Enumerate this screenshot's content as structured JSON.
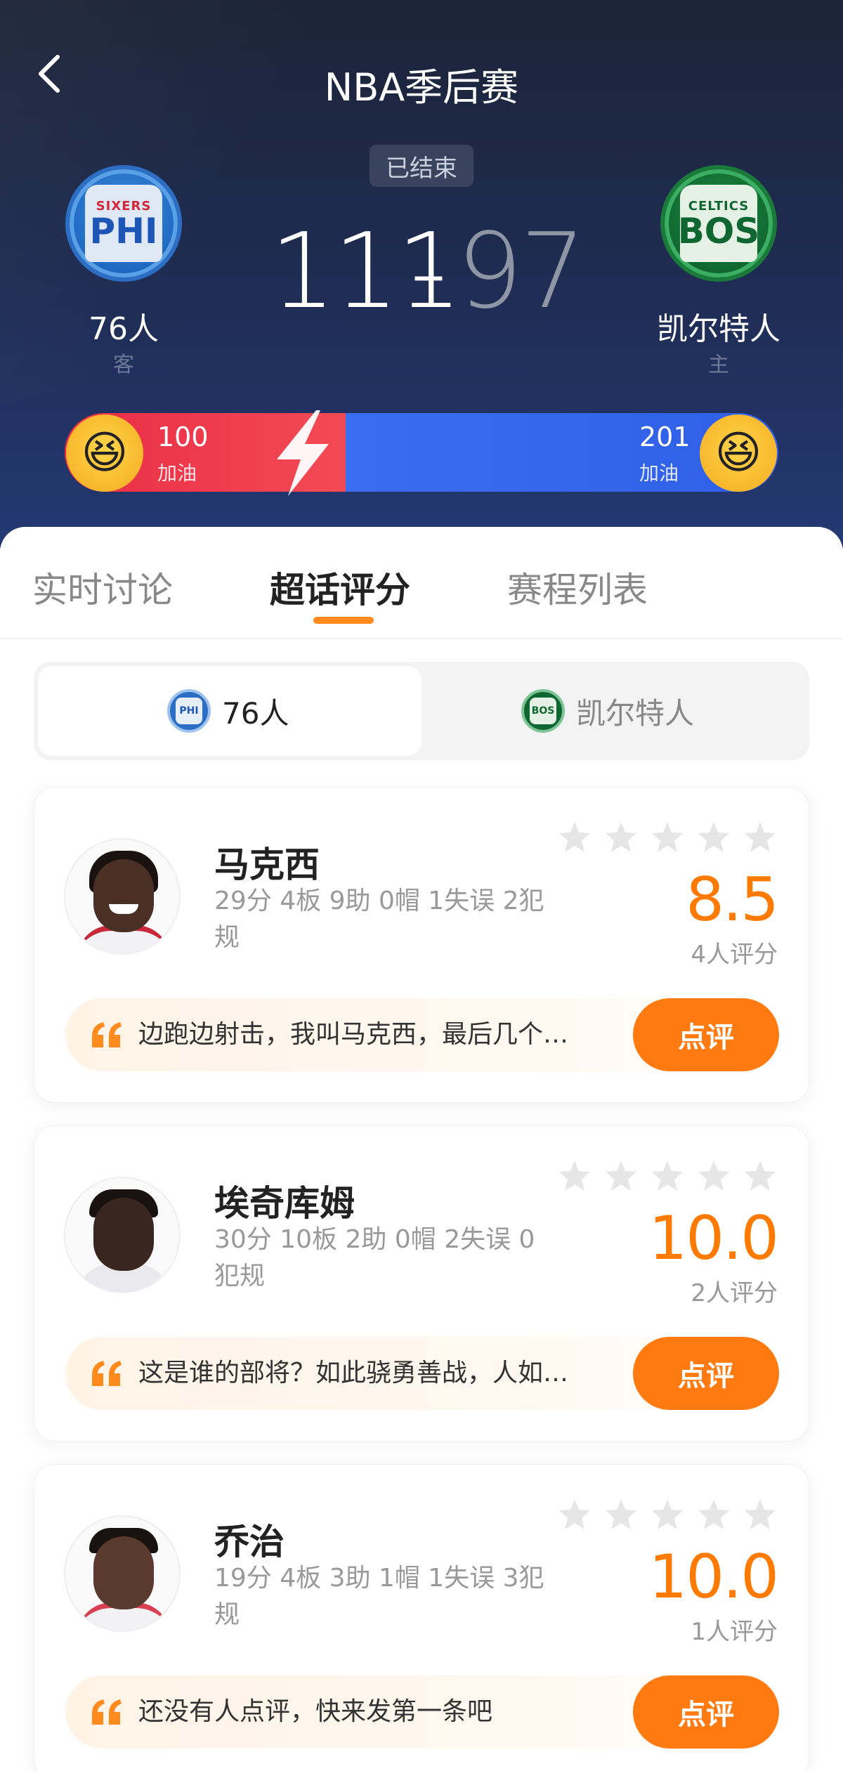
{
  "header": {
    "title": "NBA季后赛",
    "status": "已结束",
    "away_team": {
      "name": "76人",
      "role": "客",
      "logo_small": "SIXERS",
      "logo_big": "PHI",
      "score": "111"
    },
    "home_team": {
      "name": "凯尔特人",
      "role": "主",
      "logo_small": "CELTICS",
      "logo_big": "BOS",
      "score": "97"
    },
    "score_separator": "-"
  },
  "cheer": {
    "away_count": "100",
    "away_label": "加油",
    "home_count": "201",
    "home_label": "加油",
    "away_color": "#ea2c45",
    "home_color": "#3b6cf0"
  },
  "tabs": [
    {
      "label": "实时讨论"
    },
    {
      "label": "超话评分"
    },
    {
      "label": "赛程列表"
    }
  ],
  "team_toggle": {
    "left": {
      "label": "76人",
      "logo": "PHI"
    },
    "right": {
      "label": "凯尔特人",
      "logo": "BOS"
    }
  },
  "players": [
    {
      "name": "马克西",
      "stats": "29分 4板 9助 0帽 1失误 2犯规",
      "rating": "8.5",
      "raters": "4人评分",
      "comment": "边跑边射击，我叫马克西，最后几个…",
      "button": "点评"
    },
    {
      "name": "埃奇库姆",
      "stats": "30分 10板 2助 0帽 2失误 0犯规",
      "rating": "10.0",
      "raters": "2人评分",
      "comment": "这是谁的部将？如此骁勇善战，人如…",
      "button": "点评"
    },
    {
      "name": "乔治",
      "stats": "19分 4板 3助 1帽 1失误 3犯规",
      "rating": "10.0",
      "raters": "1人评分",
      "comment": "还没有人点评，快来发第一条吧",
      "button": "点评"
    }
  ],
  "colors": {
    "accent": "#ff7a10",
    "rating": "#ff7a00",
    "star_empty": "#e6e6e6"
  }
}
